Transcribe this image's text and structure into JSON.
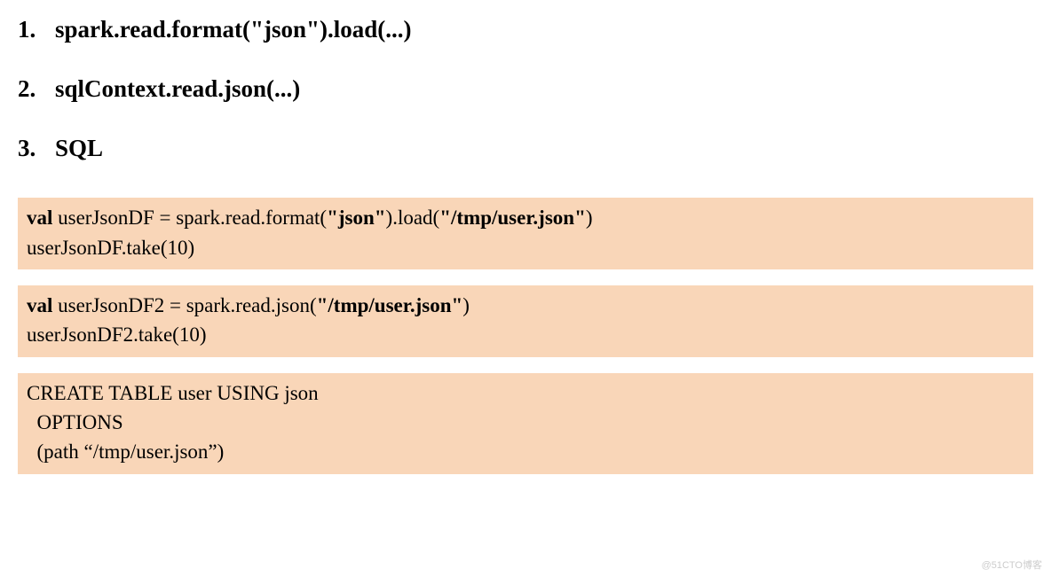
{
  "list": {
    "items": [
      "spark.read.format(\"json\").load(...)",
      "sqlContext.read.json(...)",
      "SQL"
    ]
  },
  "code": {
    "block1": {
      "t1": "val",
      "t2": " userJsonDF = spark.read.format(",
      "t3": "\"json\"",
      "t4": ").load(",
      "t5": "\"/tmp/user.json\"",
      "t6": ")",
      "line2": "userJsonDF.take(10)"
    },
    "block2": {
      "t1": "val",
      "t2": " userJsonDF2 = spark.read.json(",
      "t3": "\"/tmp/user.json\"",
      "t4": ")",
      "line2": "userJsonDF2.take(10)"
    },
    "block3": {
      "line1": "CREATE TABLE user USING json",
      "line2": "  OPTIONS",
      "line3": "  (path “/tmp/user.json”)"
    }
  },
  "watermark": "@51CTO博客"
}
